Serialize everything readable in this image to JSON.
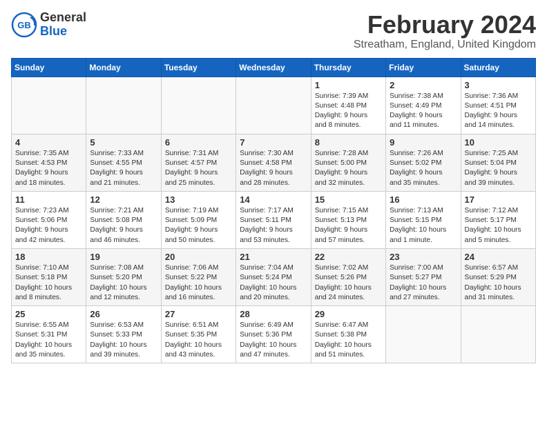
{
  "header": {
    "logo_line1": "General",
    "logo_line2": "Blue",
    "month": "February 2024",
    "location": "Streatham, England, United Kingdom"
  },
  "days_of_week": [
    "Sunday",
    "Monday",
    "Tuesday",
    "Wednesday",
    "Thursday",
    "Friday",
    "Saturday"
  ],
  "weeks": [
    [
      {
        "day": "",
        "info": ""
      },
      {
        "day": "",
        "info": ""
      },
      {
        "day": "",
        "info": ""
      },
      {
        "day": "",
        "info": ""
      },
      {
        "day": "1",
        "info": "Sunrise: 7:39 AM\nSunset: 4:48 PM\nDaylight: 9 hours\nand 8 minutes."
      },
      {
        "day": "2",
        "info": "Sunrise: 7:38 AM\nSunset: 4:49 PM\nDaylight: 9 hours\nand 11 minutes."
      },
      {
        "day": "3",
        "info": "Sunrise: 7:36 AM\nSunset: 4:51 PM\nDaylight: 9 hours\nand 14 minutes."
      }
    ],
    [
      {
        "day": "4",
        "info": "Sunrise: 7:35 AM\nSunset: 4:53 PM\nDaylight: 9 hours\nand 18 minutes."
      },
      {
        "day": "5",
        "info": "Sunrise: 7:33 AM\nSunset: 4:55 PM\nDaylight: 9 hours\nand 21 minutes."
      },
      {
        "day": "6",
        "info": "Sunrise: 7:31 AM\nSunset: 4:57 PM\nDaylight: 9 hours\nand 25 minutes."
      },
      {
        "day": "7",
        "info": "Sunrise: 7:30 AM\nSunset: 4:58 PM\nDaylight: 9 hours\nand 28 minutes."
      },
      {
        "day": "8",
        "info": "Sunrise: 7:28 AM\nSunset: 5:00 PM\nDaylight: 9 hours\nand 32 minutes."
      },
      {
        "day": "9",
        "info": "Sunrise: 7:26 AM\nSunset: 5:02 PM\nDaylight: 9 hours\nand 35 minutes."
      },
      {
        "day": "10",
        "info": "Sunrise: 7:25 AM\nSunset: 5:04 PM\nDaylight: 9 hours\nand 39 minutes."
      }
    ],
    [
      {
        "day": "11",
        "info": "Sunrise: 7:23 AM\nSunset: 5:06 PM\nDaylight: 9 hours\nand 42 minutes."
      },
      {
        "day": "12",
        "info": "Sunrise: 7:21 AM\nSunset: 5:08 PM\nDaylight: 9 hours\nand 46 minutes."
      },
      {
        "day": "13",
        "info": "Sunrise: 7:19 AM\nSunset: 5:09 PM\nDaylight: 9 hours\nand 50 minutes."
      },
      {
        "day": "14",
        "info": "Sunrise: 7:17 AM\nSunset: 5:11 PM\nDaylight: 9 hours\nand 53 minutes."
      },
      {
        "day": "15",
        "info": "Sunrise: 7:15 AM\nSunset: 5:13 PM\nDaylight: 9 hours\nand 57 minutes."
      },
      {
        "day": "16",
        "info": "Sunrise: 7:13 AM\nSunset: 5:15 PM\nDaylight: 10 hours\nand 1 minute."
      },
      {
        "day": "17",
        "info": "Sunrise: 7:12 AM\nSunset: 5:17 PM\nDaylight: 10 hours\nand 5 minutes."
      }
    ],
    [
      {
        "day": "18",
        "info": "Sunrise: 7:10 AM\nSunset: 5:18 PM\nDaylight: 10 hours\nand 8 minutes."
      },
      {
        "day": "19",
        "info": "Sunrise: 7:08 AM\nSunset: 5:20 PM\nDaylight: 10 hours\nand 12 minutes."
      },
      {
        "day": "20",
        "info": "Sunrise: 7:06 AM\nSunset: 5:22 PM\nDaylight: 10 hours\nand 16 minutes."
      },
      {
        "day": "21",
        "info": "Sunrise: 7:04 AM\nSunset: 5:24 PM\nDaylight: 10 hours\nand 20 minutes."
      },
      {
        "day": "22",
        "info": "Sunrise: 7:02 AM\nSunset: 5:26 PM\nDaylight: 10 hours\nand 24 minutes."
      },
      {
        "day": "23",
        "info": "Sunrise: 7:00 AM\nSunset: 5:27 PM\nDaylight: 10 hours\nand 27 minutes."
      },
      {
        "day": "24",
        "info": "Sunrise: 6:57 AM\nSunset: 5:29 PM\nDaylight: 10 hours\nand 31 minutes."
      }
    ],
    [
      {
        "day": "25",
        "info": "Sunrise: 6:55 AM\nSunset: 5:31 PM\nDaylight: 10 hours\nand 35 minutes."
      },
      {
        "day": "26",
        "info": "Sunrise: 6:53 AM\nSunset: 5:33 PM\nDaylight: 10 hours\nand 39 minutes."
      },
      {
        "day": "27",
        "info": "Sunrise: 6:51 AM\nSunset: 5:35 PM\nDaylight: 10 hours\nand 43 minutes."
      },
      {
        "day": "28",
        "info": "Sunrise: 6:49 AM\nSunset: 5:36 PM\nDaylight: 10 hours\nand 47 minutes."
      },
      {
        "day": "29",
        "info": "Sunrise: 6:47 AM\nSunset: 5:38 PM\nDaylight: 10 hours\nand 51 minutes."
      },
      {
        "day": "",
        "info": ""
      },
      {
        "day": "",
        "info": ""
      }
    ]
  ]
}
